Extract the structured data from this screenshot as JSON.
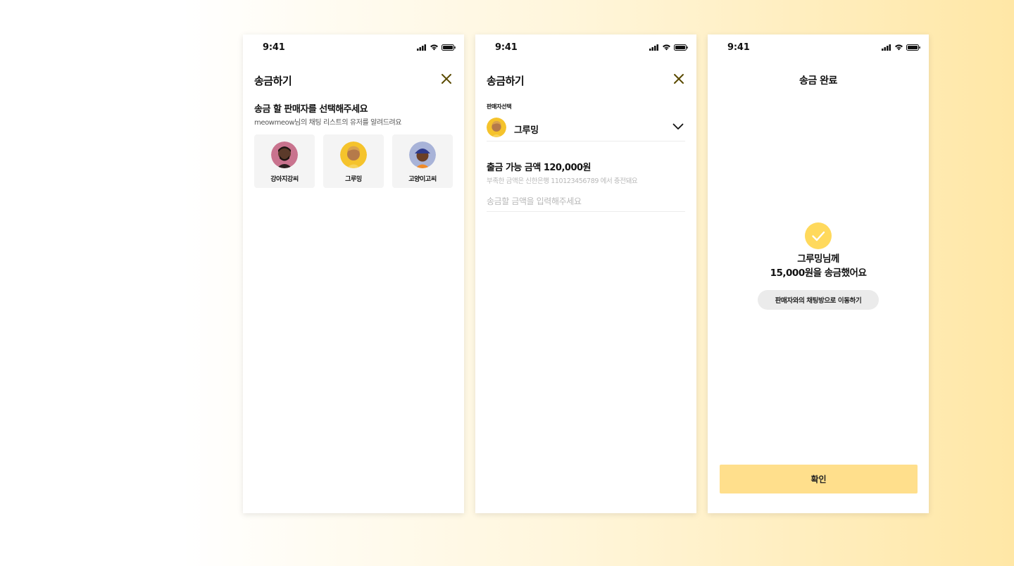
{
  "status_bar": {
    "time": "9:41"
  },
  "screen1": {
    "title": "송금하기",
    "heading": "송금 할 판매자를 선택해주세요",
    "subtext": "meowmeow님의 채팅 리스트의 유저를 알려드려요",
    "sellers": [
      {
        "name": "강아지강씨",
        "avatar_color": "#c9738e"
      },
      {
        "name": "그루밍",
        "avatar_color": "#f5c32c"
      },
      {
        "name": "고양이고씨",
        "avatar_color": "#a8b3d8"
      }
    ]
  },
  "screen2": {
    "title": "송금하기",
    "seller_label": "판매자선택",
    "selected_seller": "그루밍",
    "available_amount": "출금 가능 금액 120,000원",
    "shortfall_note": "부족한 금액은 신한은행 110123456789 에서 충전돼요",
    "amount_placeholder": "송금할 금액을 입력해주세요"
  },
  "screen3": {
    "title": "송금 완료",
    "message_line1": "그루밍님께",
    "message_line2": "15,000원을 송금했어요",
    "chat_button_label": "판매자와의 채팅방으로 이동하기",
    "confirm_button_label": "확인"
  },
  "colors": {
    "accent": "#ffd95c",
    "confirm_button": "#ffdf8c",
    "close_icon": "#5a4a00"
  }
}
